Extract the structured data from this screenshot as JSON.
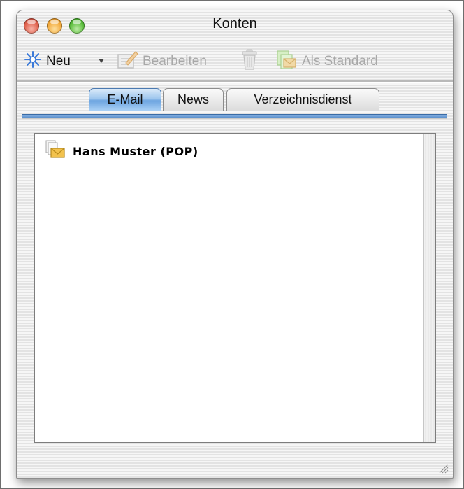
{
  "window": {
    "title": "Konten"
  },
  "toolbar": {
    "new_label": "Neu",
    "edit_label": "Bearbeiten",
    "default_label": "Als Standard"
  },
  "tabs": [
    {
      "label": "E-Mail",
      "active": true
    },
    {
      "label": "News",
      "active": false
    },
    {
      "label": "Verzeichnisdienst",
      "active": false
    }
  ],
  "accounts": [
    {
      "name": "Hans Muster (POP)"
    }
  ],
  "colors": {
    "accent_blue": "#6ca4e0",
    "close": "#e0604c",
    "minimize": "#f2a93b",
    "zoom": "#5bbd3c"
  },
  "icons": {
    "new": "star-icon",
    "edit": "edit-icon",
    "delete": "trash-icon",
    "default": "mail-default-icon",
    "account": "mail-account-icon"
  }
}
